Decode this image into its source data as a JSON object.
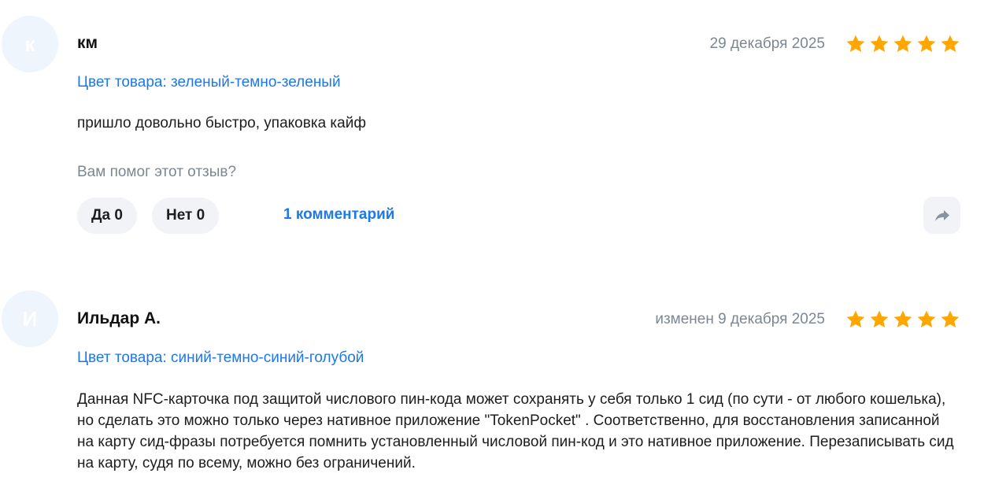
{
  "reviews": [
    {
      "avatar_letter": "к",
      "author": "км",
      "date": "29 декабря 2025",
      "rating": 5,
      "color": "Цвет товара: зеленый-темно-зеленый",
      "text": "пришло довольно быстро, упаковка кайф",
      "helpful_question": "Вам помог этот отзыв?",
      "yes_label": "Да 0",
      "no_label": "Нет 0",
      "comments_label": "1 комментарий",
      "share_icon": "share-icon"
    },
    {
      "avatar_letter": "И",
      "author": "Ильдар А.",
      "date": "изменен 9 декабря 2025",
      "rating": 5,
      "color": "Цвет товара: синий-темно-синий-голубой",
      "text": "Данная NFC-карточка под защитой числового пин-кода может сохранять у себя только 1 сид (по сути - от любого кошелька), но сделать это можно только через нативное приложение \"TokenPocket\" . Соответственно, для восстановления записанной на карту сид-фразы потребуется помнить установленный числовой пин-код и это нативное приложение. Перезаписывать сид на карту, судя по всему, можно без ограничений."
    }
  ],
  "colors": {
    "star": "#ffa600",
    "link": "#1e78e6",
    "muted": "#7d8791",
    "button_bg": "#f2f3f7",
    "avatar_bg": "#eef5fd"
  }
}
